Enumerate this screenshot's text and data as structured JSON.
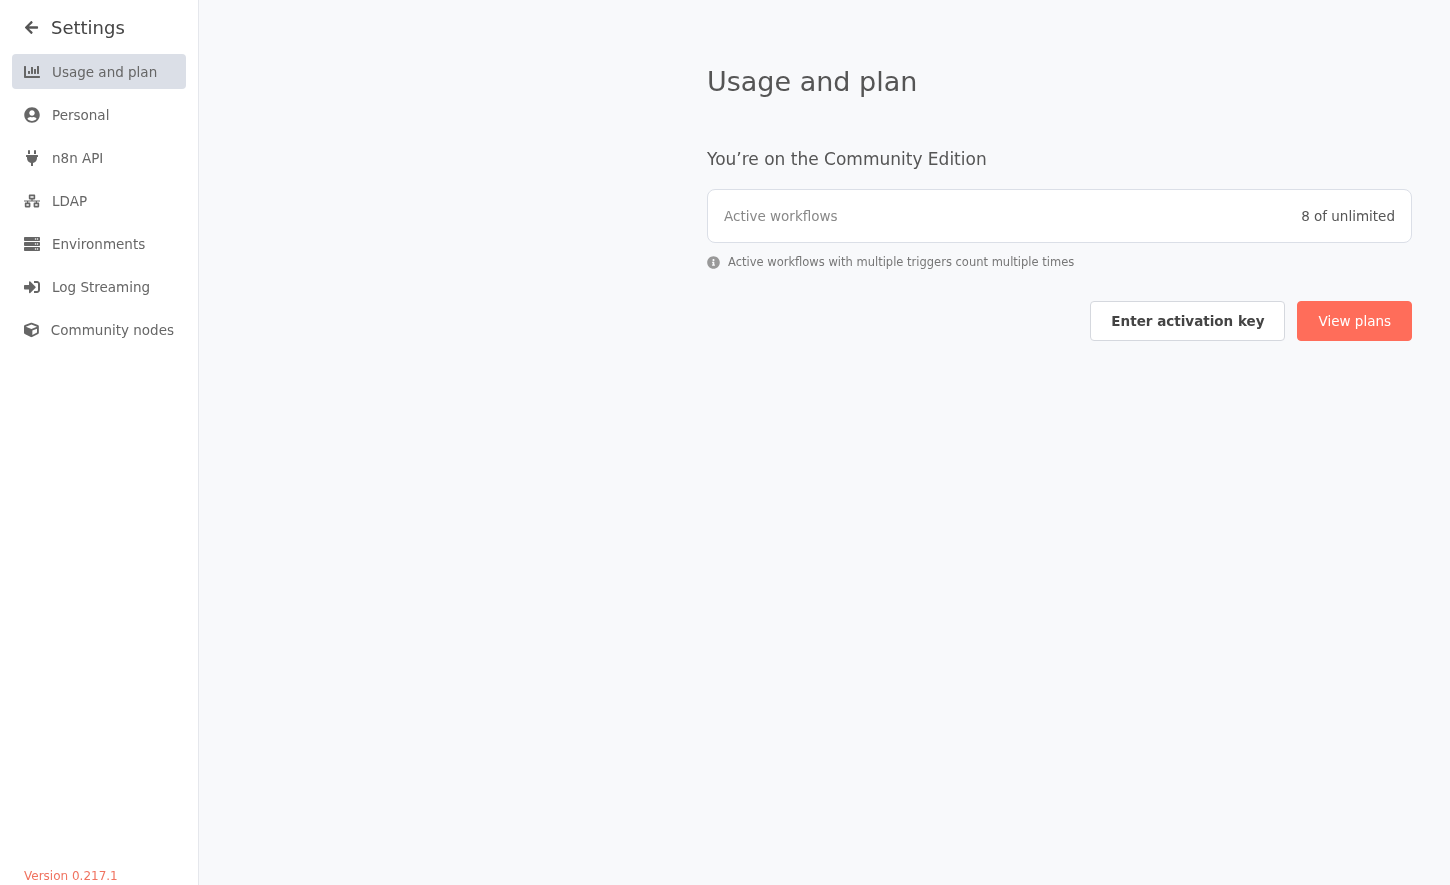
{
  "sidebar": {
    "title": "Settings",
    "items": [
      {
        "label": "Usage and plan",
        "selected": true
      },
      {
        "label": "Personal",
        "selected": false
      },
      {
        "label": "n8n API",
        "selected": false
      },
      {
        "label": "LDAP",
        "selected": false
      },
      {
        "label": "Environments",
        "selected": false
      },
      {
        "label": "Log Streaming",
        "selected": false
      },
      {
        "label": "Community nodes",
        "selected": false
      }
    ],
    "version": "Version 0.217.1"
  },
  "main": {
    "title": "Usage and plan",
    "subtitle": "You’re on the Community Edition",
    "usage": {
      "label": "Active workflows",
      "value": "8 of unlimited"
    },
    "note": "Active workflows with multiple triggers count multiple times",
    "buttons": [
      {
        "label": "Enter activation key",
        "kind": "secondary"
      },
      {
        "label": "View plans",
        "kind": "primary"
      }
    ]
  }
}
